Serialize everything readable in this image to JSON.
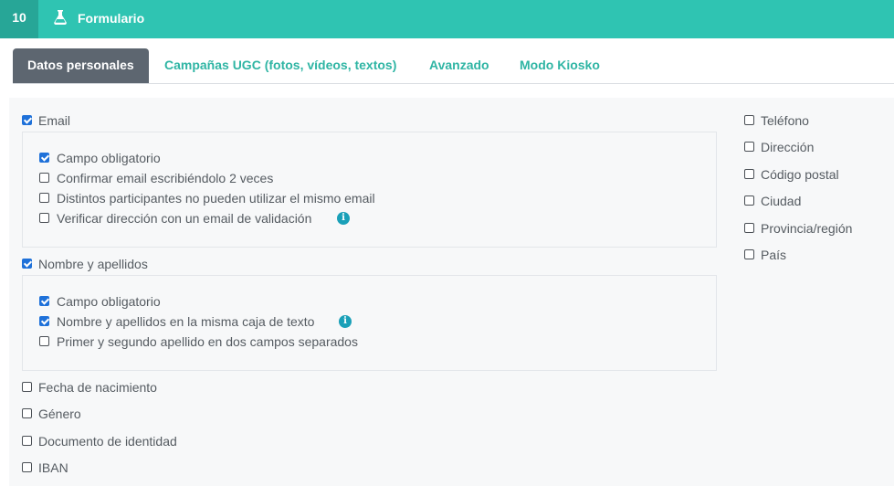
{
  "header": {
    "step_number": "10",
    "title": "Formulario",
    "icon": "flask-icon"
  },
  "tabs": [
    {
      "label": "Datos personales",
      "active": true
    },
    {
      "label": "Campañas UGC (fotos, vídeos, textos)",
      "active": false
    },
    {
      "label": "Avanzado",
      "active": false
    },
    {
      "label": "Modo Kiosko",
      "active": false
    }
  ],
  "colors": {
    "brand_teal": "#2fc4b2",
    "step_bg": "#27a697",
    "active_tab": "#5d6670",
    "checkbox_checked": "#1f71d9",
    "info_icon": "#1aa0b8"
  },
  "fields": {
    "email": {
      "label": "Email",
      "checked": true,
      "options": [
        {
          "label": "Campo obligatorio",
          "checked": true
        },
        {
          "label": "Confirmar email escribiéndolo 2 veces",
          "checked": false
        },
        {
          "label": "Distintos participantes no pueden utilizar el mismo email",
          "checked": false
        },
        {
          "label": "Verificar dirección con un email de validación",
          "checked": false,
          "info": true
        }
      ]
    },
    "name": {
      "label": "Nombre y apellidos",
      "checked": true,
      "options": [
        {
          "label": "Campo obligatorio",
          "checked": true
        },
        {
          "label": "Nombre y apellidos en la misma caja de texto",
          "checked": true,
          "info": true
        },
        {
          "label": "Primer y segundo apellido en dos campos separados",
          "checked": false
        }
      ]
    },
    "left_simple": [
      {
        "label": "Fecha de nacimiento",
        "checked": false
      },
      {
        "label": "Género",
        "checked": false
      },
      {
        "label": "Documento de identidad",
        "checked": false
      },
      {
        "label": "IBAN",
        "checked": false
      }
    ],
    "right_column": [
      {
        "label": "Teléfono",
        "checked": false
      },
      {
        "label": "Dirección",
        "checked": false
      },
      {
        "label": "Código postal",
        "checked": false
      },
      {
        "label": "Ciudad",
        "checked": false
      },
      {
        "label": "Provincia/región",
        "checked": false
      },
      {
        "label": "País",
        "checked": false
      }
    ]
  }
}
